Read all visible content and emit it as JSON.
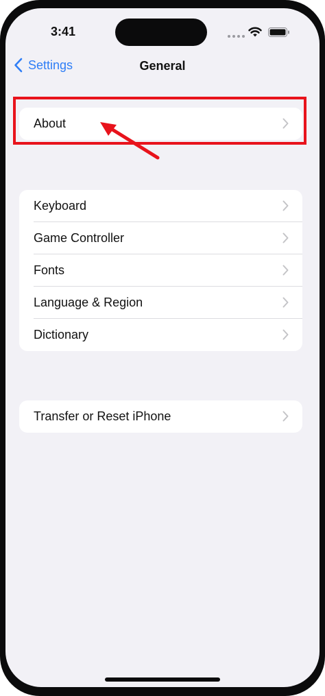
{
  "status_bar": {
    "time": "3:41",
    "icons": [
      "signal-dots-icon",
      "wifi-icon",
      "battery-icon"
    ]
  },
  "nav": {
    "back_label": "Settings",
    "title": "General"
  },
  "groups": [
    {
      "items": [
        "About"
      ]
    },
    {
      "items": [
        "Keyboard",
        "Game Controller",
        "Fonts",
        "Language & Region",
        "Dictionary"
      ]
    },
    {
      "items": [
        "Transfer or Reset iPhone"
      ]
    }
  ],
  "annotation": {
    "highlight_color": "#e8131c",
    "target": "About"
  },
  "colors": {
    "accent": "#2f7ef6",
    "background": "#f2f1f6",
    "chevron": "#c4c4c7"
  }
}
